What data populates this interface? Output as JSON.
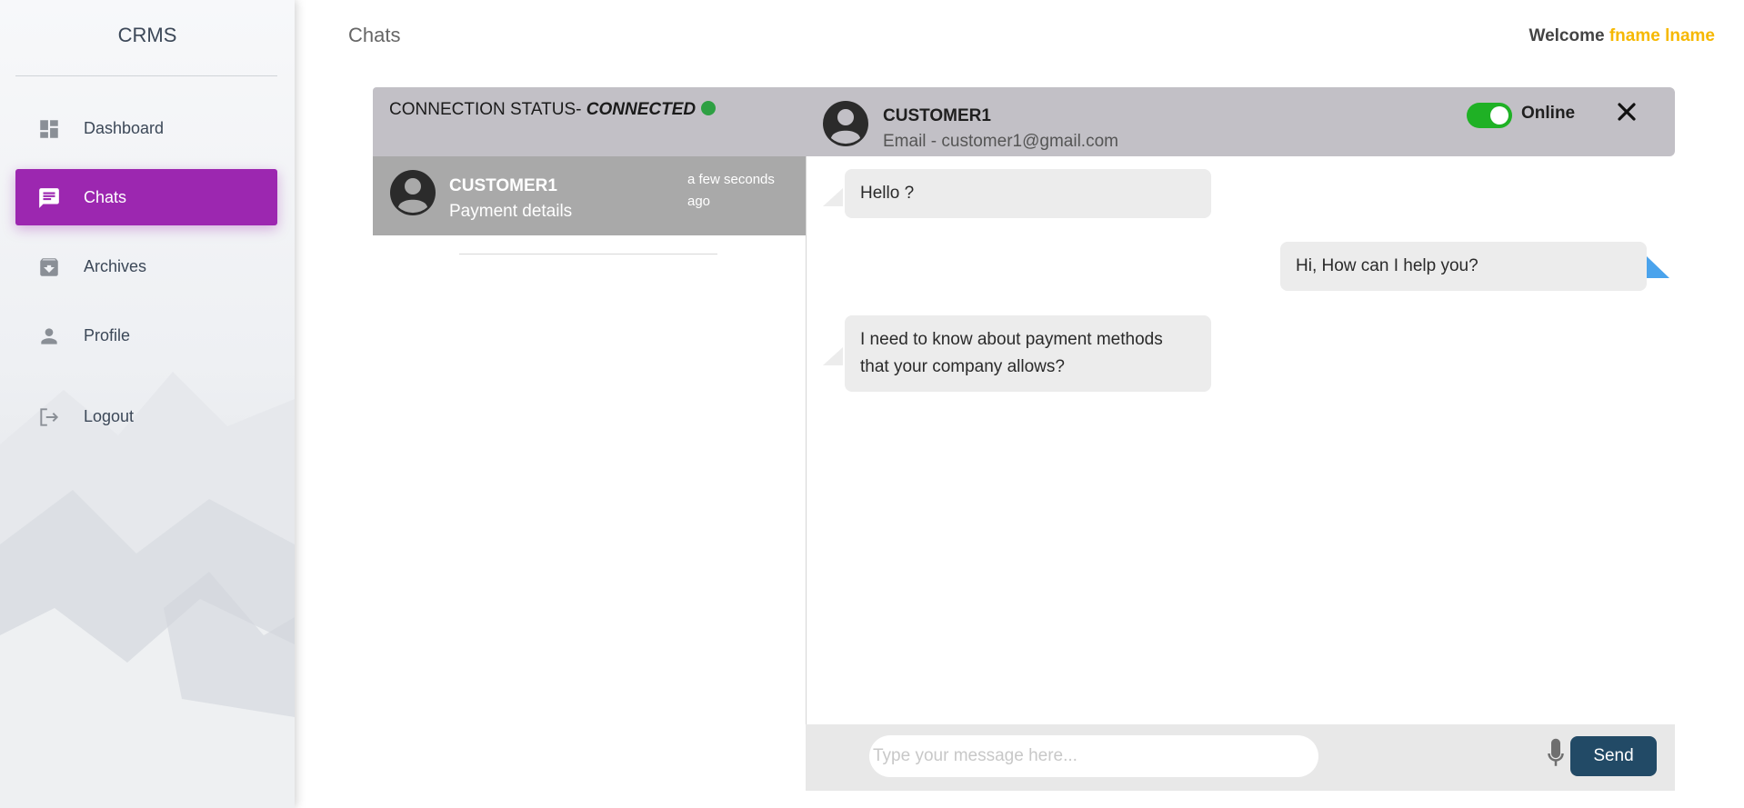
{
  "brand": "CRMS",
  "header": {
    "page_title": "Chats",
    "welcome_label": "Welcome",
    "user_name": "fname lname"
  },
  "sidebar": {
    "items": [
      {
        "label": "Dashboard",
        "icon": "dashboard-icon",
        "active": false
      },
      {
        "label": "Chats",
        "icon": "chat-icon",
        "active": true
      },
      {
        "label": "Archives",
        "icon": "archive-icon",
        "active": false
      },
      {
        "label": "Profile",
        "icon": "person-icon",
        "active": false
      },
      {
        "label": "Logout",
        "icon": "logout-icon",
        "active": false
      }
    ]
  },
  "chat_list": {
    "connection_label": "CONNECTION STATUS- ",
    "connection_status": "CONNECTED",
    "items": [
      {
        "name": "CUSTOMER1",
        "subject": "Payment details",
        "time": "a few seconds ago"
      }
    ]
  },
  "chat": {
    "customer_name": "CUSTOMER1",
    "email": "Email - customer1@gmail.com",
    "status_label": "Online",
    "status_online": true,
    "messages": [
      {
        "from": "customer",
        "text": "Hello ?"
      },
      {
        "from": "agent",
        "text": "Hi, How can I help you?"
      },
      {
        "from": "customer",
        "text": "I need to know about payment methods that your company allows?"
      }
    ]
  },
  "composer": {
    "placeholder": "Type your message here...",
    "send_label": "Send"
  },
  "colors": {
    "active_nav": "#9c27b0",
    "connected_dot": "#2ea043",
    "toggle_on": "#1fb125",
    "user_name": "#f6b800",
    "send_button": "#224a66",
    "agent_tail": "#4aa3ec"
  }
}
